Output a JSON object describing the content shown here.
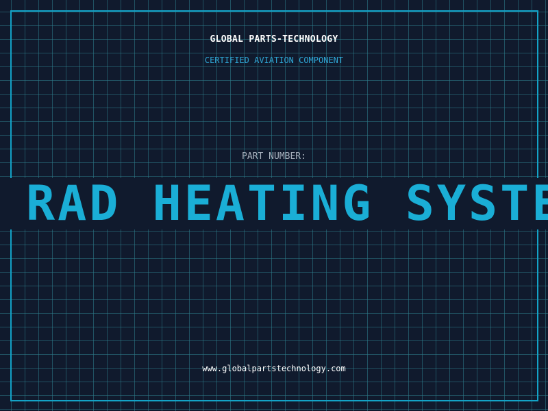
{
  "header": {
    "brand": "GLOBAL PARTS-TECHNOLOGY",
    "subtitle": "CERTIFIED AVIATION COMPONENT"
  },
  "part": {
    "label": "PART NUMBER:",
    "value": "RAD HEATING SYSTE"
  },
  "footer": {
    "url": "www.globalpartstechnology.com"
  },
  "colors": {
    "background": "#101a2d",
    "grid": "#2e7d8c",
    "frame": "#13a3c7",
    "accent": "#1aaed6",
    "subtitle": "#2fa7d6",
    "label": "#a8b1bd",
    "text": "#ffffff"
  }
}
